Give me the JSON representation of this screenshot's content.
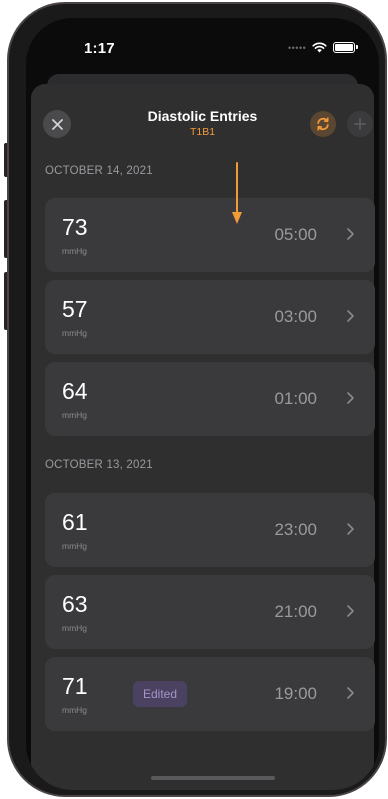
{
  "status_bar": {
    "time": "1:17",
    "cellular_icon": "signal-dots-icon",
    "wifi_icon": "wifi-icon",
    "battery_icon": "battery-icon"
  },
  "header": {
    "title": "Diastolic Entries",
    "subtitle": "T1B1",
    "close_icon": "close-icon",
    "sync_icon": "sync-icon",
    "add_icon": "plus-icon"
  },
  "colors": {
    "accent": "#f19a38",
    "row_bg": "#3a3a3c",
    "sheet_bg": "#2f2f30",
    "badge_bg": "#4b4160"
  },
  "sections": [
    {
      "date": "OCTOBER 14, 2021",
      "entries": [
        {
          "value": "73",
          "unit": "mmHg",
          "time": "05:00"
        },
        {
          "value": "57",
          "unit": "mmHg",
          "time": "03:00"
        },
        {
          "value": "64",
          "unit": "mmHg",
          "time": "01:00"
        }
      ]
    },
    {
      "date": "OCTOBER 13, 2021",
      "entries": [
        {
          "value": "61",
          "unit": "mmHg",
          "time": "23:00"
        },
        {
          "value": "63",
          "unit": "mmHg",
          "time": "21:00"
        },
        {
          "value": "71",
          "unit": "mmHg",
          "time": "19:00",
          "badge": "Edited"
        }
      ]
    }
  ]
}
